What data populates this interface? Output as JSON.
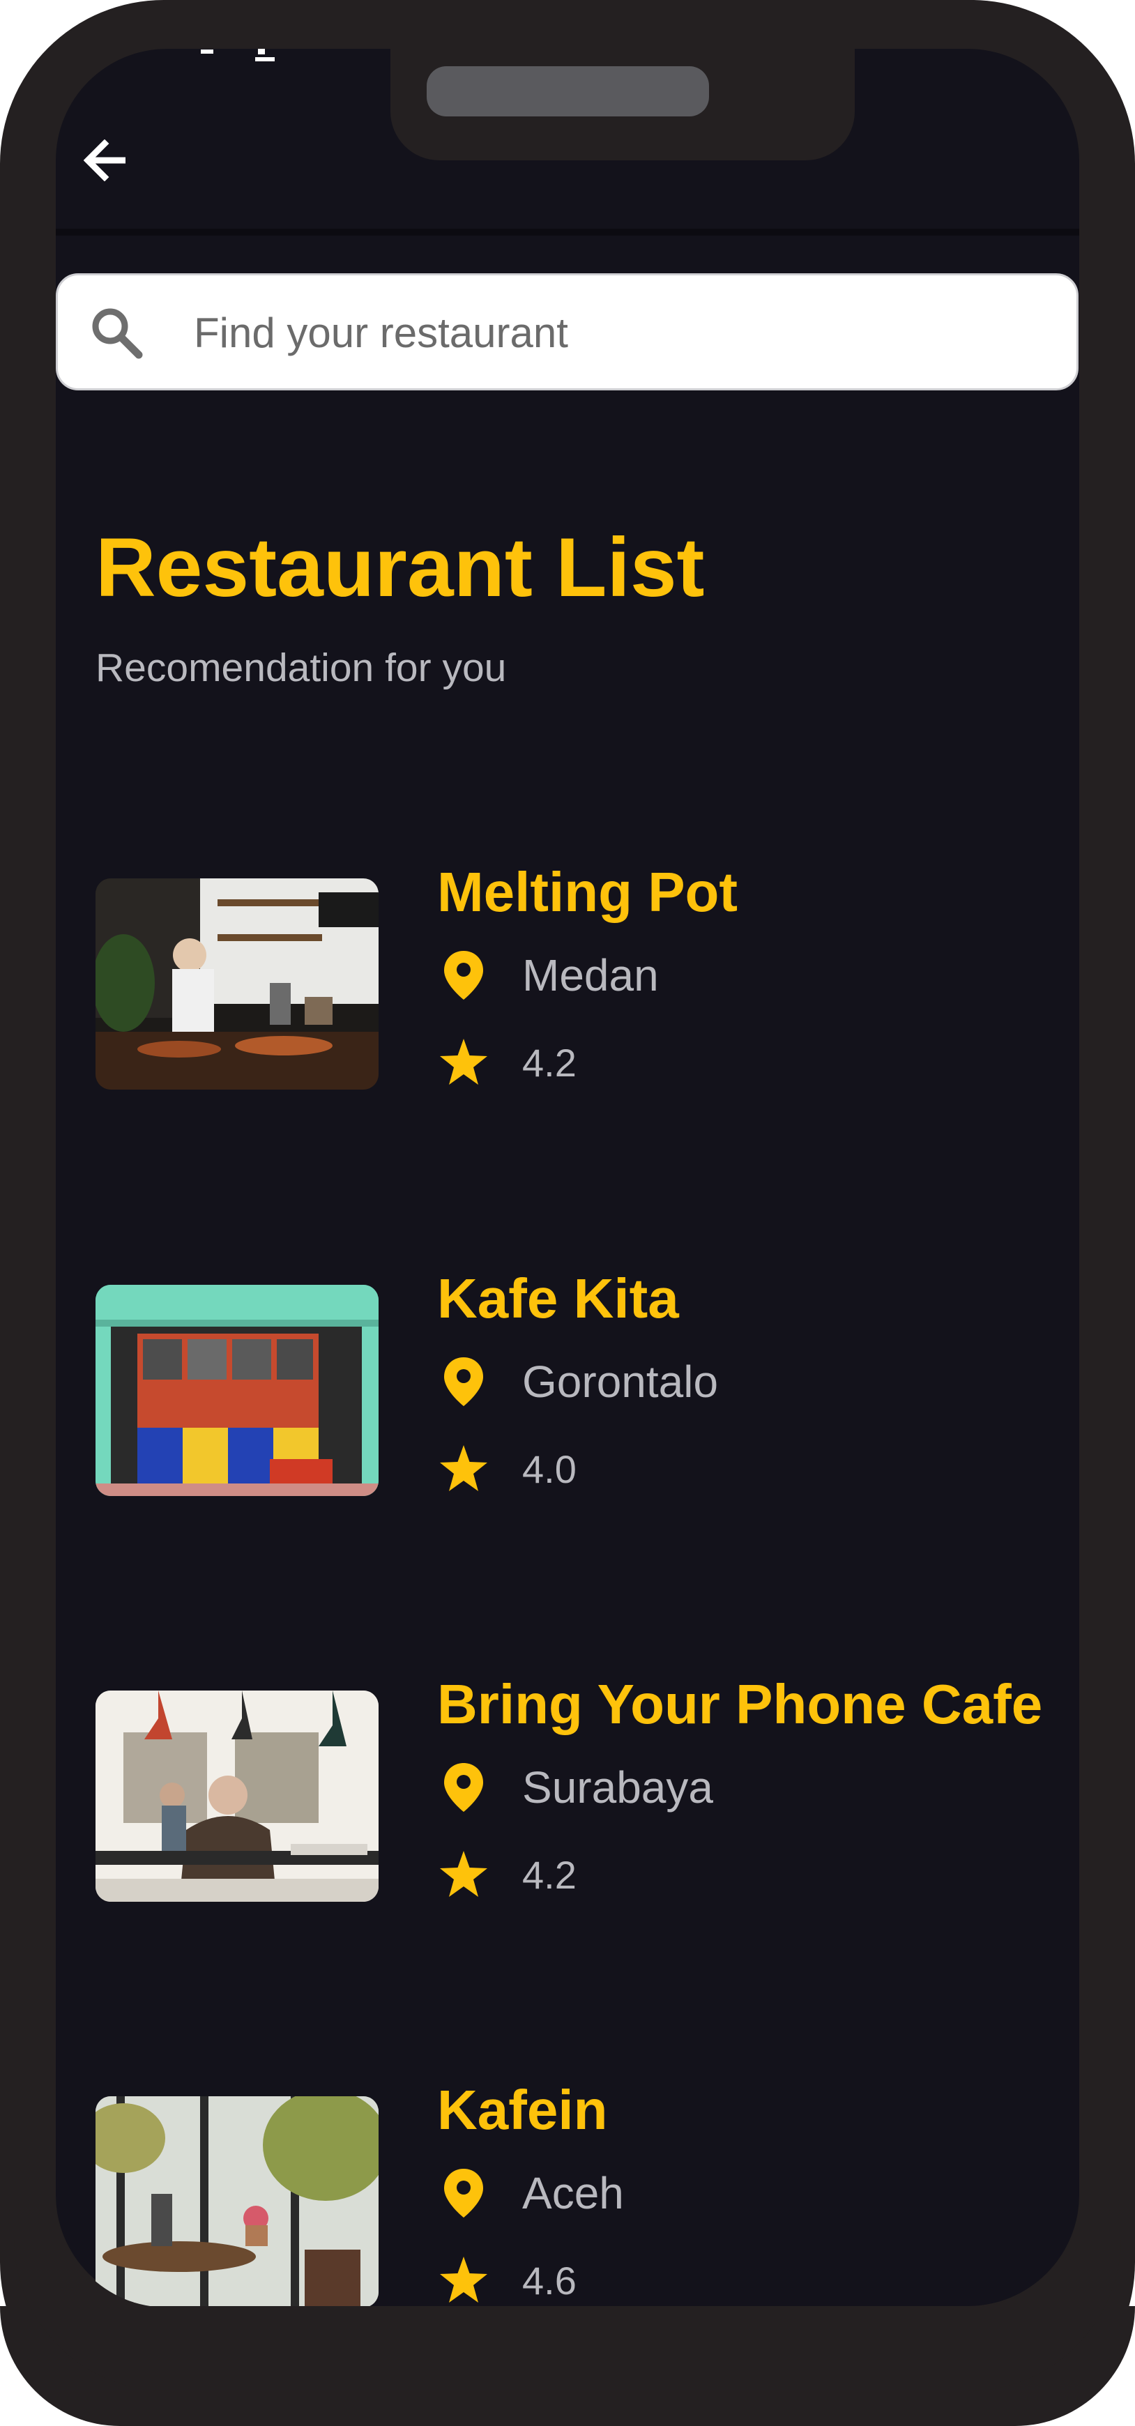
{
  "search": {
    "placeholder": "Find your restaurant"
  },
  "header": {
    "title": "Restaurant List",
    "subtitle": "Recomendation for you"
  },
  "icons": {
    "back": "arrow-left-icon",
    "search": "search-icon",
    "location": "map-pin-icon",
    "rating": "star-icon"
  },
  "colors": {
    "accent": "#fec20b",
    "background": "#13121b",
    "frame": "#242021",
    "muted_text": "#b9b9bf"
  },
  "restaurants": [
    {
      "name": "Melting Pot",
      "city": "Medan",
      "rating": "4.2"
    },
    {
      "name": "Kafe Kita",
      "city": "Gorontalo",
      "rating": "4.0"
    },
    {
      "name": "Bring Your Phone Cafe",
      "city": "Surabaya",
      "rating": "4.2"
    },
    {
      "name": "Kafein",
      "city": "Aceh",
      "rating": "4.6"
    }
  ]
}
